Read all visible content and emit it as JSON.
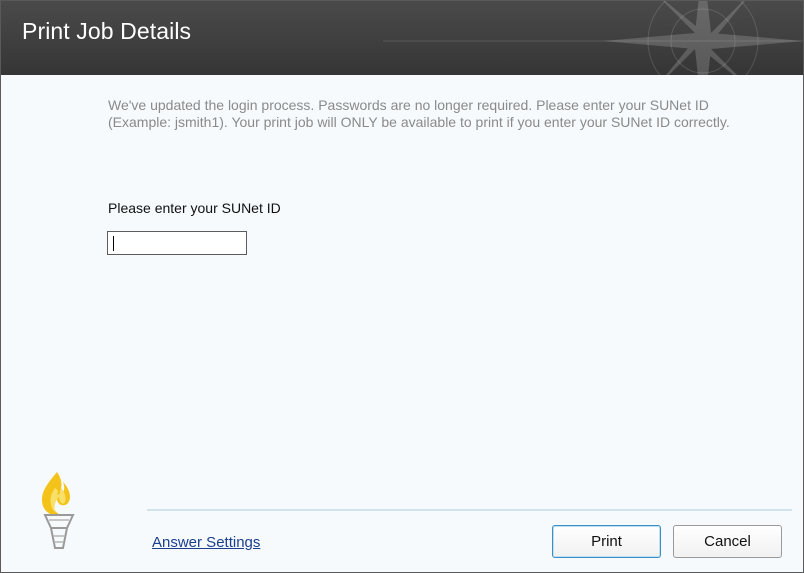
{
  "dialog": {
    "title": "Print Job Details"
  },
  "body": {
    "info_text": "We've updated the login process. Passwords are no longer required. Please enter your SUNet ID (Example: jsmith1). Your print job will ONLY be available to print if you enter your SUNet ID correctly.",
    "prompt_label": "Please enter your SUNet ID",
    "sunet_id_value": ""
  },
  "footer": {
    "answer_settings_link": "Answer Settings",
    "print_button": "Print",
    "cancel_button": "Cancel"
  },
  "icons": {
    "logo": "torch-logo-icon",
    "title_decoration": "compass-star-icon"
  },
  "colors": {
    "title_bar": "#3f3f3f",
    "content_bg": "#f6fafd",
    "info_text": "#8a8a8a",
    "link": "#1b3f8f",
    "primary_button_border": "#3a8fc6"
  }
}
